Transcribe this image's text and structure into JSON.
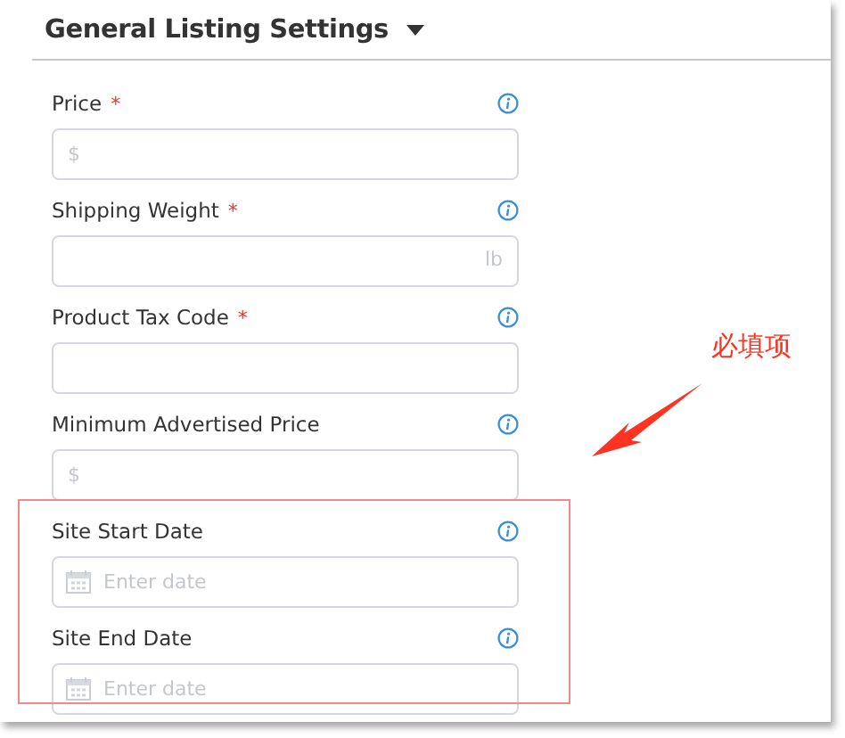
{
  "section": {
    "title": "General Listing Settings",
    "expanded": true
  },
  "fields": [
    {
      "label": "Price",
      "marker": "*",
      "kind": "text",
      "placeholder": "$"
    },
    {
      "label": "Shipping Weight",
      "marker": "*",
      "kind": "text",
      "unit": "lb"
    },
    {
      "label": "Product Tax Code",
      "marker": "*",
      "kind": "text"
    },
    {
      "label": "Minimum Advertised Price",
      "kind": "text",
      "placeholder": "$"
    },
    {
      "label": "Site Start Date",
      "kind": "date",
      "placeholder": "Enter date"
    },
    {
      "label": "Site End Date",
      "kind": "date",
      "placeholder": "Enter date"
    }
  ],
  "annotation": {
    "text": "必填项"
  }
}
